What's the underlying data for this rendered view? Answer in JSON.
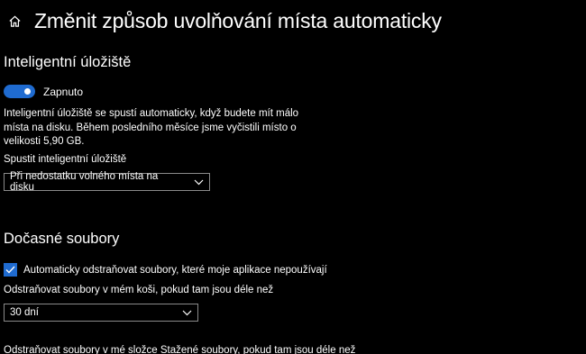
{
  "header": {
    "title": "Změnit způsob uvolňování místa automaticky",
    "home_icon": "home-icon"
  },
  "storage_sense": {
    "section_title": "Inteligentní úložiště",
    "toggle_label": "Zapnuto",
    "toggle_state": "on",
    "description": "Inteligentní úložiště se spustí automaticky, když budete mít málo místa na disku. Během posledního měsíce jsme vyčistili místo o velikosti 5,90 GB.",
    "run_label": "Spustit inteligentní úložiště",
    "run_value": "Při nedostatku volného místa na disku"
  },
  "temp_files": {
    "section_title": "Dočasné soubory",
    "auto_delete_label": "Automaticky odstraňovat soubory, které moje aplikace nepoužívají",
    "auto_delete_checked": true,
    "recycle_label": "Odstraňovat soubory v mém koši, pokud tam jsou déle než",
    "recycle_value": "30 dní",
    "downloads_label": "Odstraňovat soubory v mé složce Stažené soubory, pokud tam jsou déle než"
  },
  "colors": {
    "background": "#000000",
    "accent": "#1f6bd0",
    "text": "#ffffff",
    "border": "#8a8a8a"
  }
}
